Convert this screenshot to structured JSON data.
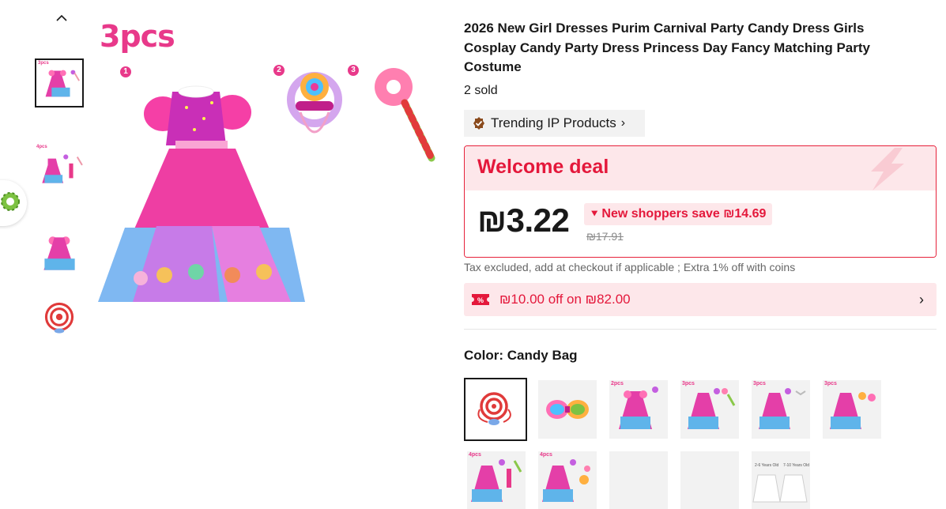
{
  "gallery": {
    "thumbnails": [
      {
        "tag": "3pcs"
      },
      {
        "tag": "4pcs"
      },
      {
        "tag": ""
      },
      {
        "tag": ""
      }
    ],
    "main_tag": "3pcs",
    "badges": [
      "1",
      "2",
      "3"
    ]
  },
  "product": {
    "title": "2026 New Girl Dresses Purim Carnival Party Candy Dress Girls Cosplay Candy Party Dress Princess Day Fancy Matching Party Costume",
    "sold": "2 sold",
    "trending_label": "Trending IP Products",
    "trending_chevron": "›"
  },
  "deal": {
    "title": "Welcome deal",
    "price": "₪3.22",
    "save_text": "New shoppers save ₪14.69",
    "original_price": "₪17.91",
    "tax_note": "Tax excluded, add at checkout if applicable ; Extra 1% off with coins"
  },
  "coupon": {
    "icon_text": "%",
    "text": "₪10.00 off on ₪82.00",
    "chevron": "›"
  },
  "color": {
    "label": "Color: Candy Bag",
    "options": [
      {
        "tag": "",
        "kind": "candy-bag"
      },
      {
        "tag": "",
        "kind": "bows"
      },
      {
        "tag": "2pcs",
        "kind": "dress-set"
      },
      {
        "tag": "3pcs",
        "kind": "dress-set"
      },
      {
        "tag": "3pcs",
        "kind": "dress-set"
      },
      {
        "tag": "3pcs",
        "kind": "dress-set"
      },
      {
        "tag": "4pcs",
        "kind": "dress-set"
      },
      {
        "tag": "4pcs",
        "kind": "dress-set"
      },
      {
        "tag": "",
        "kind": "empty"
      },
      {
        "tag": "",
        "kind": "empty"
      },
      {
        "tag": "",
        "kind": "petticoat",
        "labels": [
          "2-6 Years Old",
          "7-10 Years Old"
        ]
      }
    ]
  },
  "colors": {
    "accent_red": "#e4183b",
    "pink_bg": "#fde7ea",
    "tag_pink": "#e8398a"
  }
}
